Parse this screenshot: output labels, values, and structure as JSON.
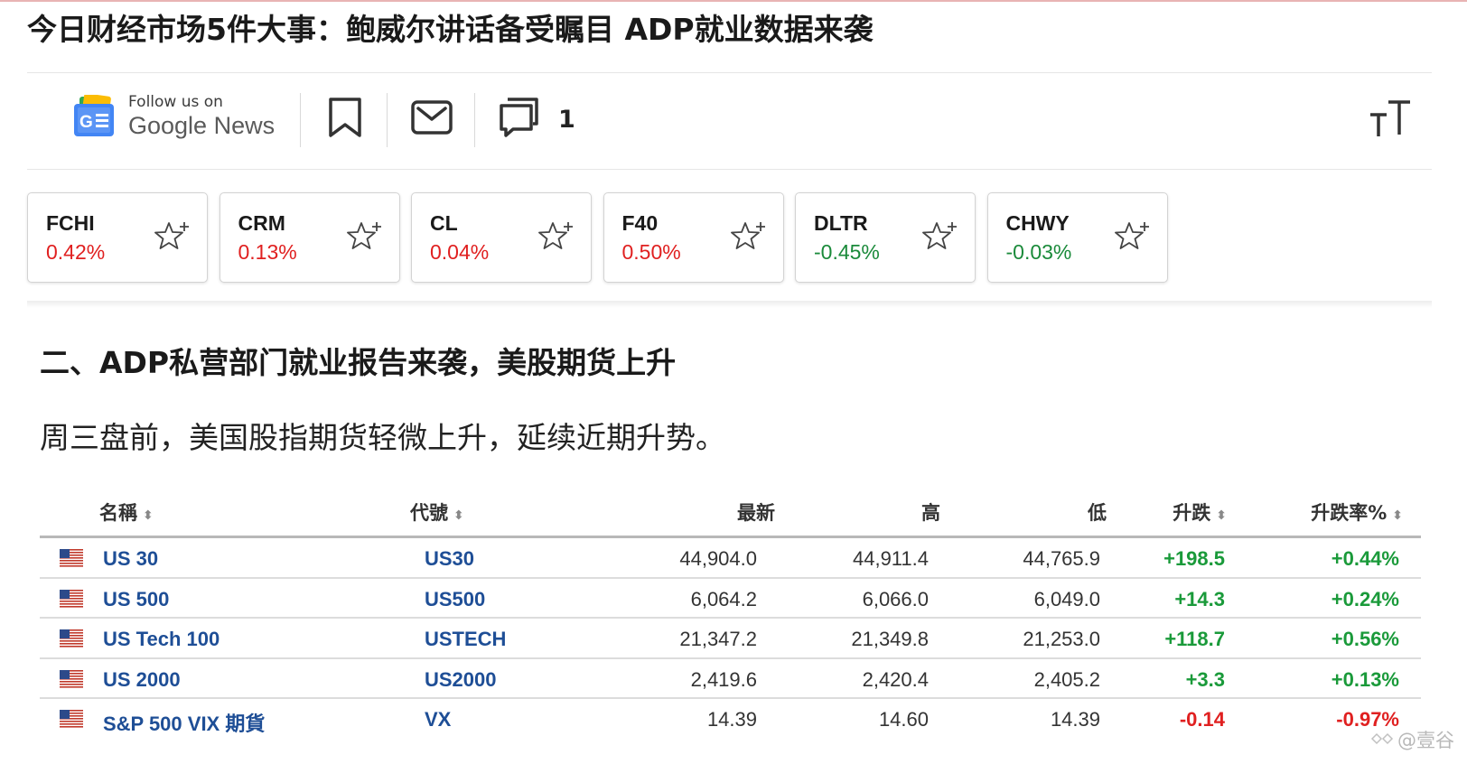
{
  "headline": "今日财经市场5件大事：鲍威尔讲话备受瞩目 ADP就业数据来袭",
  "share_bar": {
    "google_news": {
      "follow_text": "Follow us on",
      "brand_text": "Google News"
    },
    "comment_count": "1",
    "icons": [
      "google-news-icon",
      "bookmark-icon",
      "mail-icon",
      "comment-icon",
      "text-size-icon"
    ]
  },
  "tickers": [
    {
      "symbol": "FCHI",
      "change": "0.42%",
      "direction": "up"
    },
    {
      "symbol": "CRM",
      "change": "0.13%",
      "direction": "up"
    },
    {
      "symbol": "CL",
      "change": "0.04%",
      "direction": "up"
    },
    {
      "symbol": "F40",
      "change": "0.50%",
      "direction": "up"
    },
    {
      "symbol": "DLTR",
      "change": "-0.45%",
      "direction": "down"
    },
    {
      "symbol": "CHWY",
      "change": "-0.03%",
      "direction": "down"
    }
  ],
  "section_heading": "二、ADP私营部门就业报告来袭，美股期货上升",
  "paragraph": "周三盘前，美国股指期货轻微上升，延续近期升势。",
  "table": {
    "headers": {
      "name": "名稱",
      "code": "代號",
      "last": "最新",
      "high": "高",
      "low": "低",
      "change": "升跌",
      "change_pct": "升跌率%"
    },
    "rows": [
      {
        "name": "US 30",
        "code": "US30",
        "last": "44,904.0",
        "high": "44,911.4",
        "low": "44,765.9",
        "change": "+198.5",
        "change_pct": "+0.44%",
        "direction": "up"
      },
      {
        "name": "US 500",
        "code": "US500",
        "last": "6,064.2",
        "high": "6,066.0",
        "low": "6,049.0",
        "change": "+14.3",
        "change_pct": "+0.24%",
        "direction": "up"
      },
      {
        "name": "US Tech 100",
        "code": "USTECH",
        "last": "21,347.2",
        "high": "21,349.8",
        "low": "21,253.0",
        "change": "+118.7",
        "change_pct": "+0.56%",
        "direction": "up"
      },
      {
        "name": "US 2000",
        "code": "US2000",
        "last": "2,419.6",
        "high": "2,420.4",
        "low": "2,405.2",
        "change": "+3.3",
        "change_pct": "+0.13%",
        "direction": "up"
      },
      {
        "name": "S&P 500 VIX 期貨",
        "code": "VX",
        "last": "14.39",
        "high": "14.60",
        "low": "14.39",
        "change": "-0.14",
        "change_pct": "-0.97%",
        "direction": "down"
      }
    ]
  },
  "watermark": "@壹谷",
  "colors": {
    "up_ticker": "#e02020",
    "down_ticker": "#1a8a3a",
    "up_table": "#1a9a3a",
    "down_table": "#e02020",
    "link_blue": "#1e4e96"
  }
}
